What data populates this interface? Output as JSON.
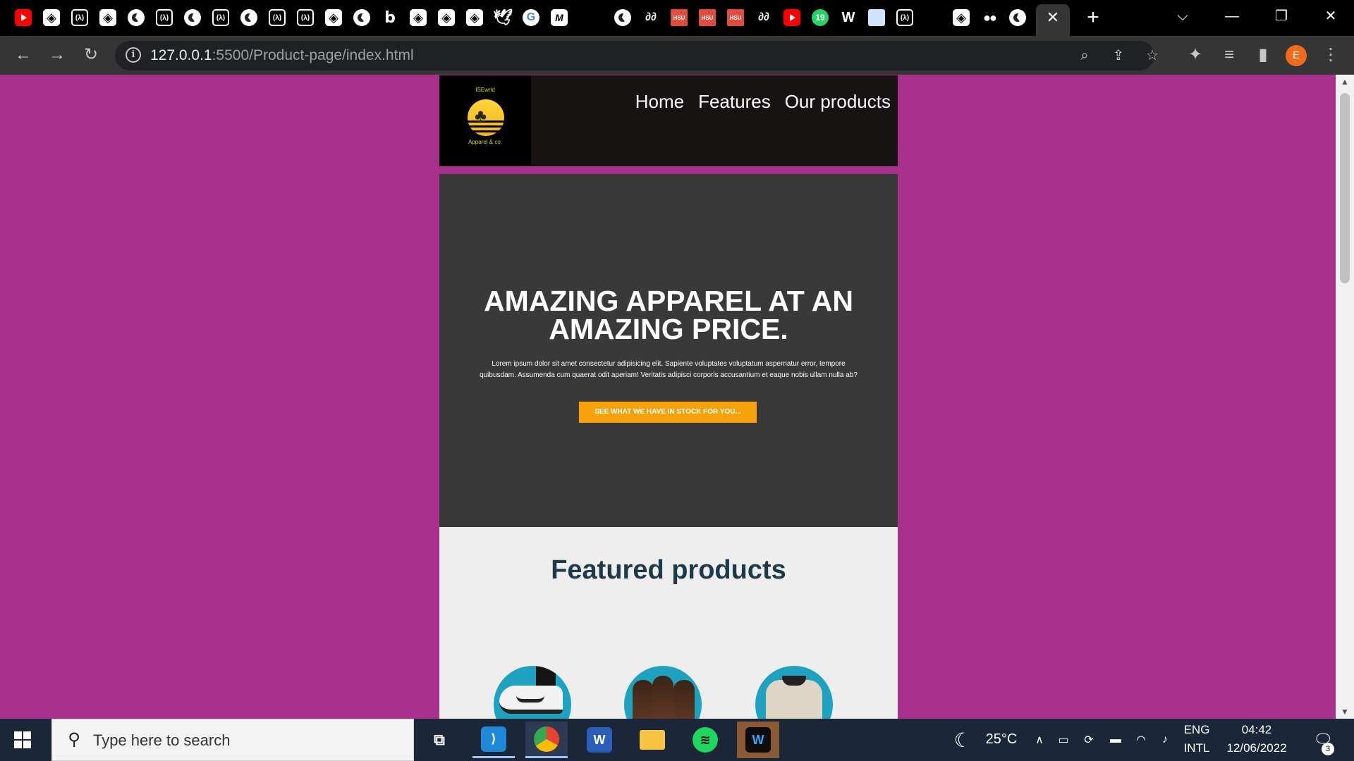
{
  "browser": {
    "tabs_favicons": [
      "youtube-icon",
      "codepen-icon",
      "freecodecamp-icon",
      "codepen-icon",
      "globe-icon",
      "freecodecamp-icon",
      "globe-icon",
      "freecodecamp-icon",
      "globe-icon",
      "freecodecamp-icon",
      "freecodecamp-icon",
      "codepen-icon",
      "globe-icon",
      "bing-icon",
      "codepen-icon",
      "codepen-icon",
      "codepen-icon",
      "twitter-icon",
      "google-icon",
      "medium-icon",
      "globe-icon",
      "geeksforgeeks-icon",
      "hsu-icon",
      "hsu-icon",
      "hsu-icon",
      "geeksforgeeks-icon",
      "youtube-icon",
      "whatsapp-icon",
      "w3schools-icon",
      "image-icon",
      "freecodecamp-icon",
      "codepen-icon",
      "medium-icon",
      "globe-icon"
    ],
    "hsu_label": "HSU",
    "whatsapp_count": "19",
    "close_tab": "✕",
    "new_tab": "+",
    "window": {
      "dropdown": "⌵",
      "minimize": "—",
      "restore": "❐",
      "close": "✕"
    },
    "url_host": "127.0.0.1",
    "url_rest": ":5500/Product-page/index.html",
    "profile_initial": "E"
  },
  "site": {
    "logo_top": "ISEwrld",
    "logo_bottom": "Apparel & co.",
    "nav": [
      "Home",
      "Features",
      "Our products"
    ],
    "hero_title": "AMAZING APPAREL AT AN AMAZING PRICE.",
    "hero_text": "Lorem ipsum dolor sit amet consectetur adipisicing elit. Sapiente voluptates voluptatum aspernatur error, tempore quibusdam. Assumenda cum quaerat odit aperiam! Veritatis adipisci corporis accusantium et eaque nobis ullam nulla ab?",
    "hero_button": "SEE WHAT WE HAVE IN STOCK FOR YOU...",
    "featured_title": "Featured products"
  },
  "taskbar": {
    "search_placeholder": "Type here to search",
    "temperature": "25°C",
    "lang_top": "ENG",
    "lang_bottom": "INTL",
    "time": "04:42",
    "date": "12/06/2022",
    "notifications": "3",
    "word_label": "W"
  },
  "colors": {
    "page_bg": "#a8318e",
    "hero_bg": "#3a3939",
    "cta": "#f8a20b",
    "featured_title": "#1d3a4a",
    "product_circle": "#1ea2c0"
  }
}
